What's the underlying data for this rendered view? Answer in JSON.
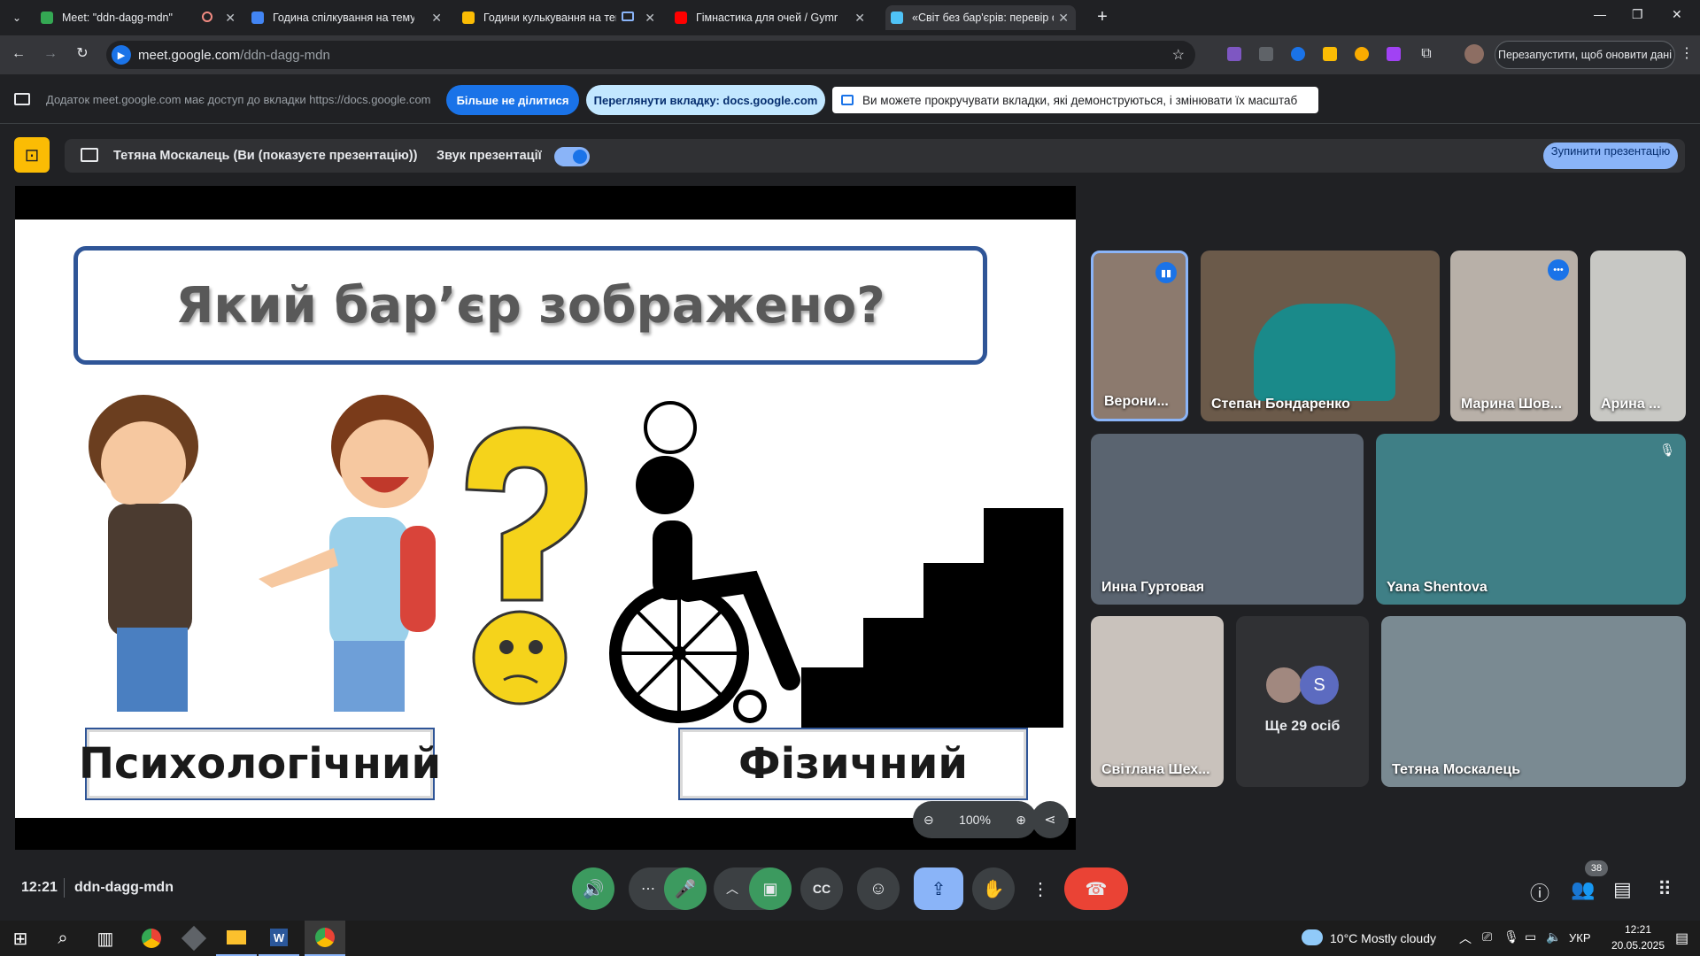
{
  "browser": {
    "tabs": [
      {
        "title": "Meet: \"ddn-dagg-mdn\"",
        "color": "#34a853"
      },
      {
        "title": "Година спілкування на тему: «",
        "color": "#4285f4"
      },
      {
        "title": "Години кулькування на тем",
        "color": "#fbbc04"
      },
      {
        "title": "Гімнастика для очей / Gymnas",
        "color": "#ff0000"
      },
      {
        "title": "«Світ без бар'єрів: перевір себ",
        "color": "#4fc3f7"
      }
    ],
    "url_host": "meet.google.com",
    "url_path": "/ddn-dagg-mdn",
    "relaunch_label": "Перезапустити, щоб оновити дані"
  },
  "sharebar": {
    "message": "Додаток meet.google.com має доступ до вкладки https://docs.google.com",
    "stop_sharing": "Більше не ділитися",
    "view_tab": "Переглянути вкладку: docs.google.com",
    "info": "Ви можете прокручувати вкладки, які демонструються, і змінювати їх масштаб"
  },
  "presenting": {
    "presenter_text": "Тетяна Москалець (Ви (показуєте презентацію))",
    "sound_label": "Звук презентації",
    "stop_button": "Зупинити презентацію"
  },
  "slide": {
    "question": "Який бар’єр зображено?",
    "label_left": "Психологічний",
    "label_right": "Фізичний",
    "zoom": "100%"
  },
  "participants": [
    {
      "name": "Верони...",
      "bg": "#8c7a6e"
    },
    {
      "name": "Степан Бондаренко",
      "bg": "#6b5a4a"
    },
    {
      "name": "Марина Шов...",
      "bg": "#b8b0a8"
    },
    {
      "name": "Арина ...",
      "bg": "#c8c8c4"
    },
    {
      "name": "Инна Гуртовая",
      "bg": "#5a6470"
    },
    {
      "name": "Yana Shentova",
      "bg": "#3f7f86"
    },
    {
      "name": "Світлана Шех...",
      "bg": "#c9c2bc"
    },
    {
      "name": "Тетяна Москалець",
      "bg": "#7a8a92"
    }
  ],
  "more_people": {
    "label": "Ще 29 осіб",
    "initial": "S"
  },
  "meeting": {
    "time": "12:21",
    "code": "ddn-dagg-mdn",
    "people_count": "38"
  },
  "taskbar": {
    "weather": "10°C  Mostly cloudy",
    "lang": "УКР",
    "clock_time": "12:21",
    "clock_date": "20.05.2025"
  }
}
